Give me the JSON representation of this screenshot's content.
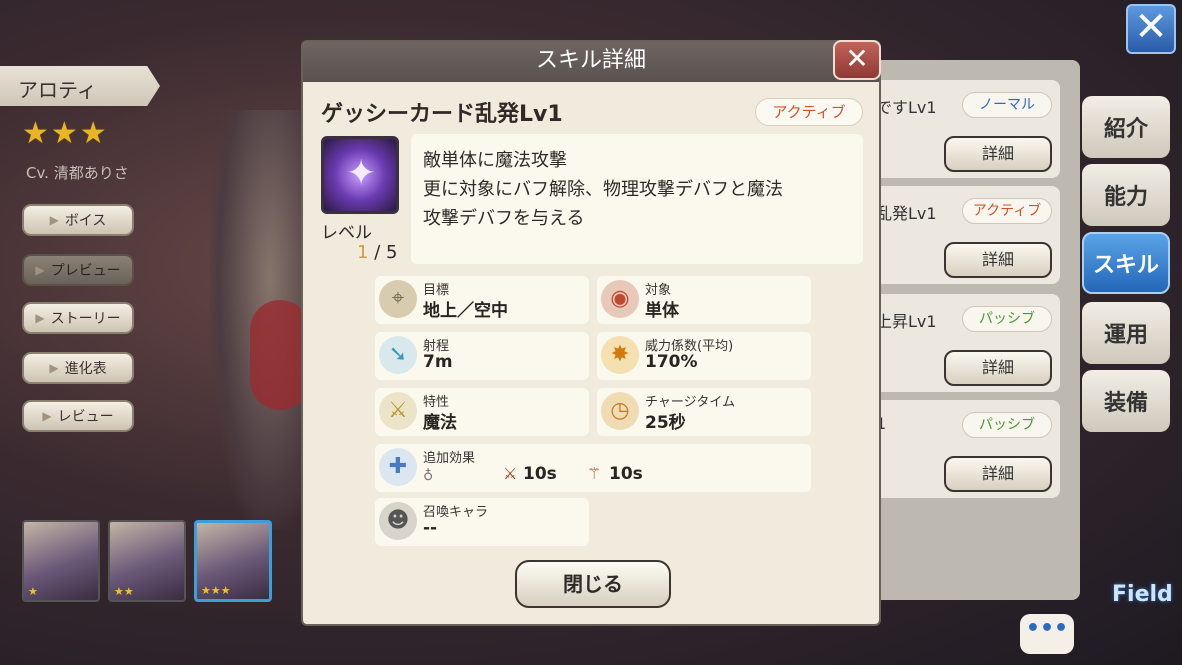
{
  "character": {
    "name": "アロティ",
    "stars": "★★★",
    "cv": "Cv. 清都ありさ"
  },
  "side_buttons": [
    {
      "label": "ボイス"
    },
    {
      "label": "プレビュー"
    },
    {
      "label": "ストーリー"
    },
    {
      "label": "進化表"
    },
    {
      "label": "レビュー"
    }
  ],
  "thumbnails": [
    {
      "stars": "★"
    },
    {
      "stars": "★★"
    },
    {
      "stars": "★★★"
    }
  ],
  "skill_list": [
    {
      "name": "ですLv1",
      "badge": "ノーマル",
      "detail": "詳細"
    },
    {
      "name": "乱発Lv1",
      "badge": "アクティブ",
      "detail": "詳細"
    },
    {
      "name": "上昇Lv1",
      "badge": "パッシブ",
      "detail": "詳細"
    },
    {
      "name": "1",
      "badge": "パッシブ",
      "detail": "詳細"
    }
  ],
  "tabs": [
    {
      "label": "紹介"
    },
    {
      "label": "能力"
    },
    {
      "label": "スキル"
    },
    {
      "label": "運用"
    },
    {
      "label": "装備"
    }
  ],
  "top_close_glyph": "✕",
  "chat_glyph": "•••",
  "field_label": "Field",
  "modal": {
    "header": "スキル詳細",
    "close_glyph": "✕",
    "skill_name": "ゲッシーカード乱発Lv1",
    "skill_type": "アクティブ",
    "level_label": "レベル",
    "level_current": "1",
    "level_max": "/ 5",
    "description": [
      "敵単体に魔法攻撃",
      "更に対象にバフ解除、物理攻撃デバフと魔法",
      "攻撃デバフを与える"
    ],
    "stats": {
      "target_label": "目標",
      "target_value": "地上／空中",
      "object_label": "対象",
      "object_value": "単体",
      "range_label": "射程",
      "range_value": "7m",
      "power_label": "威力係数(平均)",
      "power_value": "170%",
      "trait_label": "特性",
      "trait_value": "魔法",
      "charge_label": "チャージタイム",
      "charge_value": "25秒",
      "extra_label": "追加効果",
      "extra_a": "10s",
      "extra_b": "10s",
      "summon_label": "召喚キャラ",
      "summon_value": "--"
    },
    "close_button": "閉じる"
  }
}
